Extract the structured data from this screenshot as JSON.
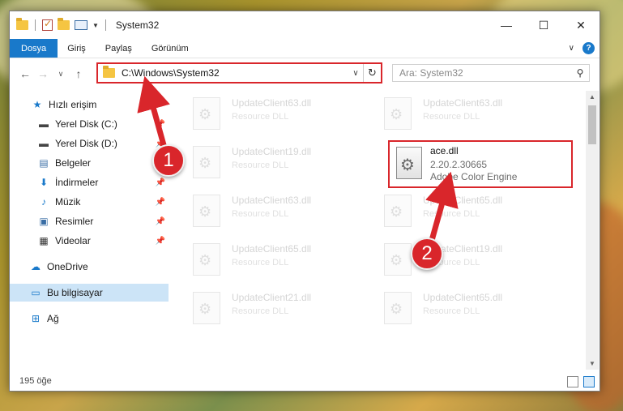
{
  "window": {
    "title": "System32",
    "controls": {
      "minimize": "—",
      "maximize": "☐",
      "close": "✕"
    }
  },
  "ribbon": {
    "tabs": [
      "Dosya",
      "Giriş",
      "Paylaş",
      "Görünüm"
    ],
    "help": "?"
  },
  "address": {
    "path": "C:\\Windows\\System32",
    "search_placeholder": "Ara: System32"
  },
  "sidebar": {
    "items": [
      {
        "label": "Hızlı erişim",
        "icon": "star-icon",
        "pinned": false
      },
      {
        "label": "Yerel Disk (C:)",
        "icon": "drive-icon",
        "pinned": true
      },
      {
        "label": "Yerel Disk (D:)",
        "icon": "drive-icon",
        "pinned": true
      },
      {
        "label": "Belgeler",
        "icon": "documents-icon",
        "pinned": true
      },
      {
        "label": "İndirmeler",
        "icon": "download-icon",
        "pinned": true
      },
      {
        "label": "Müzik",
        "icon": "music-icon",
        "pinned": true
      },
      {
        "label": "Resimler",
        "icon": "pictures-icon",
        "pinned": true
      },
      {
        "label": "Videolar",
        "icon": "videos-icon",
        "pinned": true
      },
      {
        "label": "OneDrive",
        "icon": "cloud-icon",
        "pinned": false
      },
      {
        "label": "Bu bilgisayar",
        "icon": "computer-icon",
        "pinned": false,
        "selected": true
      },
      {
        "label": "Ağ",
        "icon": "network-icon",
        "pinned": false
      }
    ]
  },
  "files": {
    "faded": [
      {
        "name": "UpdateClient63.dll",
        "desc": "Resource DLL"
      },
      {
        "name": "UpdateClient63.dll",
        "desc": "Resource DLL"
      },
      {
        "name": "UpdateClient19.dll",
        "desc": "Resource DLL"
      },
      {
        "name": "UpdateClient63.dll",
        "desc": "Resource DLL"
      },
      {
        "name": "UpdateClient65.dll",
        "desc": "Resource DLL"
      },
      {
        "name": "UpdateClient65.dll",
        "desc": "Resource DLL"
      },
      {
        "name": "UpdateClient19.dll",
        "desc": "Resource DLL"
      },
      {
        "name": "UpdateClient21.dll",
        "desc": "Resource DLL"
      },
      {
        "name": "UpdateClient65.dll",
        "desc": "Resource DLL"
      }
    ],
    "highlighted": {
      "name": "ace.dll",
      "version": "2.20.2.30665",
      "description": "Adobe Color Engine"
    }
  },
  "status": {
    "item_count": "195 öğe"
  },
  "callouts": {
    "one": "1",
    "two": "2",
    "color": "#d9262b"
  }
}
